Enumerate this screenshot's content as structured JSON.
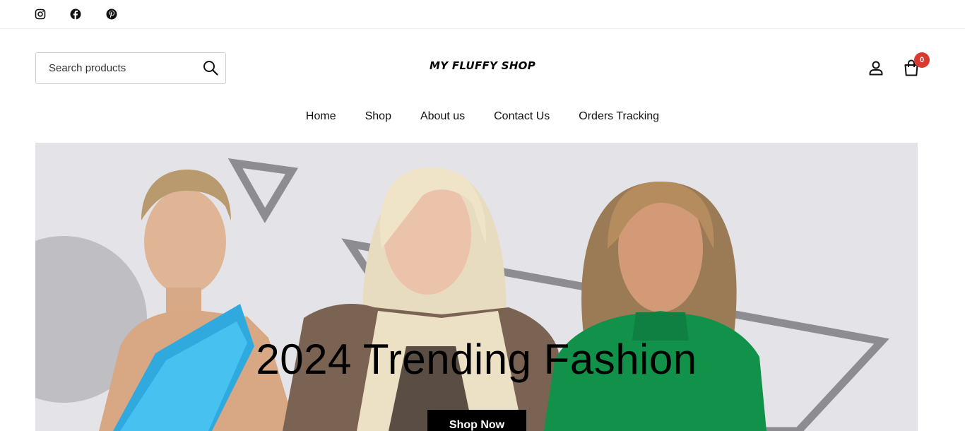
{
  "social": [
    "instagram-icon",
    "facebook-icon",
    "pinterest-icon"
  ],
  "search": {
    "placeholder": "Search products"
  },
  "brand": {
    "name": "MY FLUFFY SHOP"
  },
  "cart": {
    "count": "0"
  },
  "nav": {
    "items": [
      "Home",
      "Shop",
      "About us",
      "Contact Us",
      "Orders Tracking"
    ]
  },
  "hero": {
    "title": "2024 Trending Fashion",
    "cta": "Shop Now"
  },
  "colors": {
    "accent": "#d93a2f",
    "hero_bg": "#e4e3e7",
    "button_bg": "#000000"
  }
}
